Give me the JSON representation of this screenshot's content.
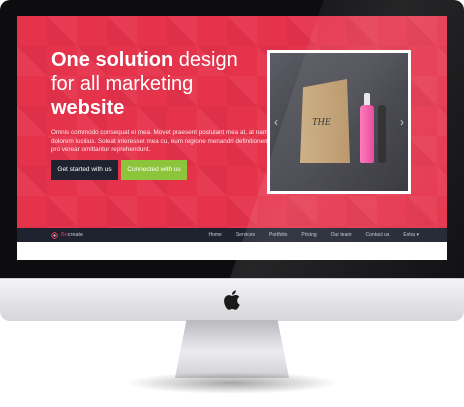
{
  "hero": {
    "headline_bold_1": "One solution",
    "headline_rest_1": " design for all marketing ",
    "headline_bold_2": "website",
    "description": "Omnis commodo consequat ei mea. Movet praesent postulant mea at, at nam dolorem lucilius. Soleat interesset mea cu, eum regione menandri definitionem no, ei pro verear omittantur reprehendunt.",
    "btn_primary": "Get started with us",
    "btn_secondary": "Connected with us"
  },
  "slider": {
    "product_label": "THE",
    "prev_icon": "chevron-left-icon",
    "next_icon": "chevron-right-icon"
  },
  "nav": {
    "logo_accent": "Bo",
    "logo_rest": "create",
    "items": [
      "Home",
      "Services",
      "Portfolio",
      "Pricing",
      "Our team",
      "Contact us",
      "Extra ▾"
    ]
  },
  "colors": {
    "hero_red": "#e5334b",
    "nav_dark": "#1f2330",
    "secondary_green": "#8cc43b"
  }
}
